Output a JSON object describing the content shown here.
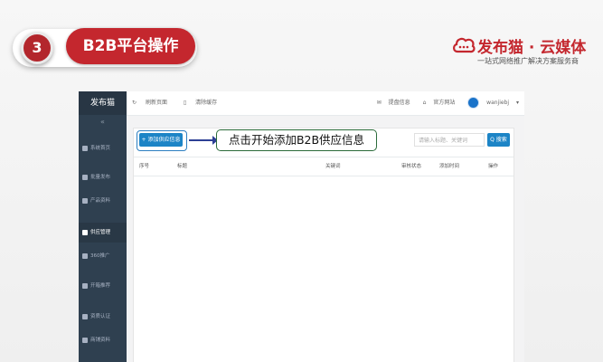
{
  "step": {
    "number": "3",
    "title": "B2B平台操作"
  },
  "brand": {
    "name": "发布猫 · 云媒体",
    "tagline": "一站式网络推广解决方案服务商",
    "icon": "cloud-chat-icon",
    "color": "#c4272e"
  },
  "app": {
    "logo": "发布猫",
    "collapse_glyph": "«",
    "sidebar": [
      {
        "label": "系统首页",
        "icon": "home-icon"
      },
      {
        "label": "批量发布",
        "icon": "send-icon"
      },
      {
        "label": "产品资料",
        "icon": "box-icon"
      },
      {
        "label": "供应管理",
        "icon": "list-icon",
        "active": true
      },
      {
        "label": "360推广",
        "icon": "search-icon"
      },
      {
        "label": "开箱推荐",
        "icon": "gift-icon"
      },
      {
        "label": "资质认证",
        "icon": "badge-icon"
      },
      {
        "label": "商铺资料",
        "icon": "store-icon"
      }
    ],
    "topbar": {
      "refresh": "刷新页面",
      "clear_cache": "清除缓存",
      "message": "提盘信息",
      "site": "官方网站",
      "user": "wanjiebj",
      "caret": "▾"
    },
    "toolbar": {
      "add_button": "+ 添加供应信息",
      "callout": "点击开始添加B2B供应信息",
      "search_placeholder": "请输入标题、关键词",
      "search_button": "Q 搜索"
    },
    "table": {
      "headers": [
        "序号",
        "标题",
        "关键词",
        "审核状态",
        "添加时间",
        "操作"
      ]
    }
  }
}
